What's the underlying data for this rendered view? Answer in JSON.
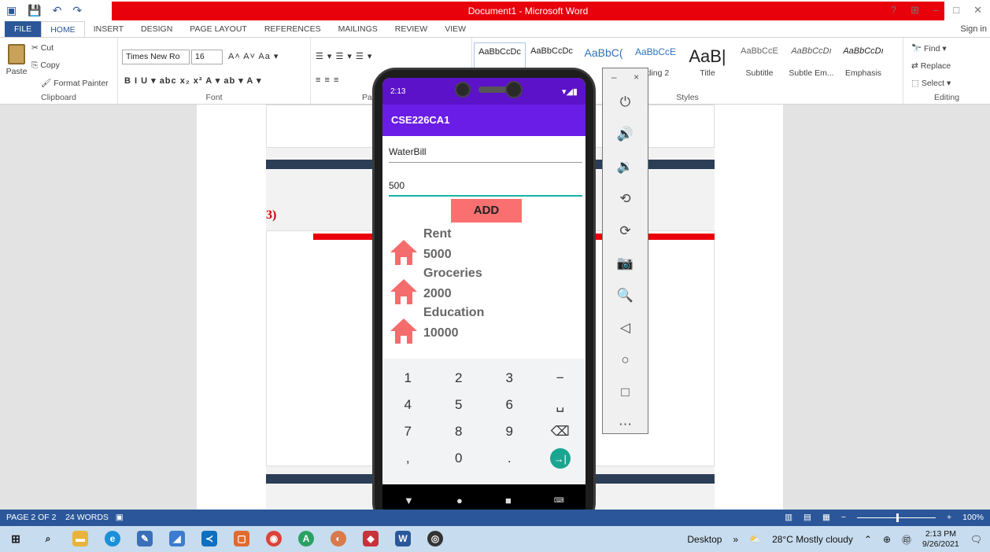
{
  "window": {
    "title": "Document1 - Microsoft Word",
    "help": "?",
    "restore": "⊞",
    "minimize": "–",
    "maximize": "□",
    "close": "✕"
  },
  "qat": {
    "save_icon": "💾",
    "undo_icon": "↶",
    "redo_icon": "↷"
  },
  "ribbon_tabs": [
    "FILE",
    "HOME",
    "INSERT",
    "DESIGN",
    "PAGE LAYOUT",
    "REFERENCES",
    "MAILINGS",
    "REVIEW",
    "VIEW"
  ],
  "sign_in": "Sign in",
  "clipboard": {
    "paste": "Paste",
    "cut": "Cut",
    "copy": "Copy",
    "format_painter": "Format Painter",
    "label": "Clipboard"
  },
  "font": {
    "name": "Times New Ro",
    "size": "16",
    "label": "Font",
    "row1": "A˄ A˅  Aa ▾",
    "row2": "B  I  U ▾ abc x₂ x²  A ▾ ab ▾ A ▾"
  },
  "paragraph": {
    "label": "Pa"
  },
  "styles": {
    "items": [
      {
        "sample": "AaBbCcDc",
        "name": ""
      },
      {
        "sample": "AaBbCcDc",
        "name": ""
      },
      {
        "sample": "AaBbC(",
        "name": ""
      },
      {
        "sample": "AaBbCcE",
        "name": "ading 2"
      },
      {
        "sample": "AaB|",
        "name": "Title"
      },
      {
        "sample": "AaBbCcE",
        "name": "Subtitle"
      },
      {
        "sample": "AaBbCcDı",
        "name": "Subtle Em..."
      },
      {
        "sample": "AaBbCcDı",
        "name": "Emphasis"
      }
    ],
    "label": "Styles"
  },
  "editing": {
    "find": "Find ▾",
    "replace": "Replace",
    "select": "Select ▾",
    "label": "Editing"
  },
  "document": {
    "section_number": "3)"
  },
  "statusbar": {
    "page": "PAGE 2 OF 2",
    "words": "24 WORDS",
    "zoom": "100%"
  },
  "taskbar": {
    "desktop": "Desktop",
    "weather": "28°C  Mostly cloudy",
    "time": "2:13 PM",
    "date": "9/26/2021"
  },
  "phone": {
    "time": "2:13",
    "app_title": "CSE226CA1",
    "field1_value": "WaterBill",
    "field2_value": "500",
    "add_label": "ADD",
    "items": [
      {
        "name": "Rent",
        "amount": "5000"
      },
      {
        "name": "Groceries",
        "amount": "2000"
      },
      {
        "name": "Education",
        "amount": "10000"
      }
    ],
    "keys": [
      "1",
      "2",
      "3",
      "−",
      "4",
      "5",
      "6",
      "␣",
      "7",
      "8",
      "9",
      "⌫",
      ",",
      "0",
      ".",
      "→|"
    ]
  },
  "emulator": {
    "minimize": "–",
    "close": "×",
    "icons": [
      "power-icon",
      "volume-up-icon",
      "volume-down-icon",
      "rotate-left-icon",
      "rotate-right-icon",
      "camera-icon",
      "zoom-icon",
      "back-icon",
      "home-icon",
      "overview-icon",
      "more-icon"
    ],
    "glyphs": [
      "⏻",
      "🔊",
      "🔉",
      "⟲",
      "⟳",
      "📷",
      "🔍",
      "◁",
      "○",
      "□",
      "⋯"
    ]
  },
  "colors": {
    "word_blue": "#2b579a",
    "title_red": "#e8000b",
    "app_purple": "#6a1de6",
    "add_button": "#fa7070",
    "accent_teal": "#17b3a3"
  }
}
